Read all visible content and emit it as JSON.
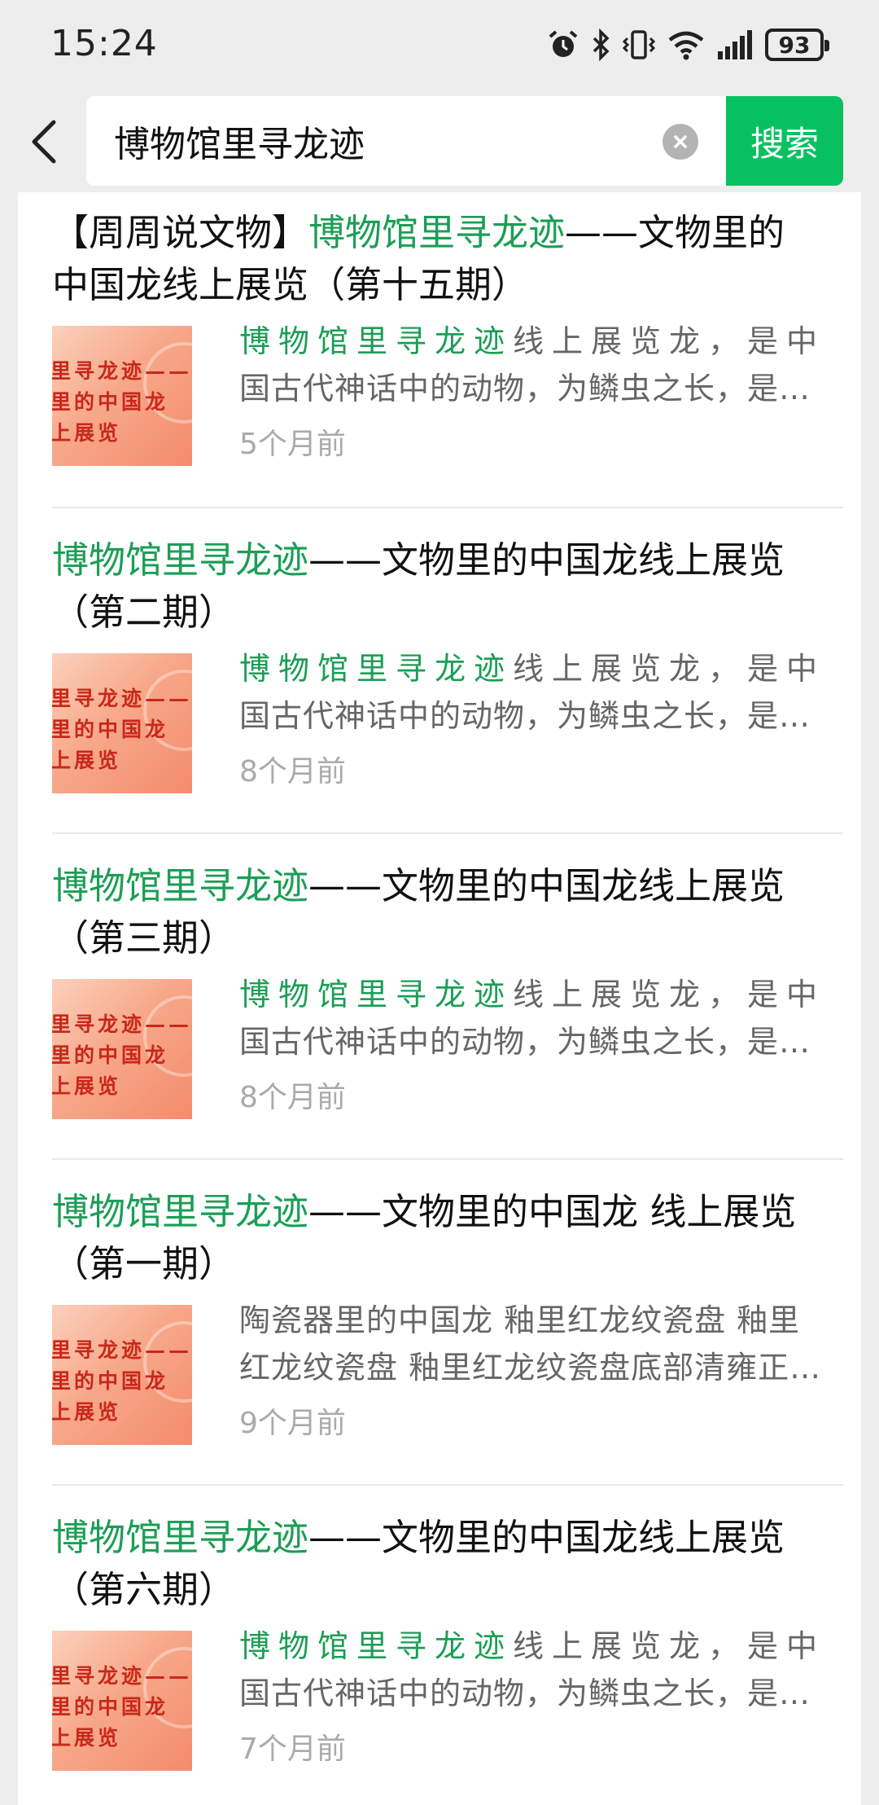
{
  "status_bar": {
    "time": "15:24",
    "battery": "93",
    "icons": [
      "alarm-icon",
      "bluetooth-icon",
      "vibrate-icon",
      "wifi-icon",
      "signal-icon",
      "battery-icon"
    ]
  },
  "search": {
    "query": "博物馆里寻龙迹",
    "button_label": "搜索"
  },
  "results": [
    {
      "title_prefix": "【周周说文物】",
      "title_highlight": "博物馆里寻龙迹",
      "title_line1_rest": "——文物里的",
      "title_line2": "中国龙线上展览（第十五期）",
      "snippet_highlight": "博物馆里寻龙迹",
      "snippet_line1_rest": "线上展览龙，是中",
      "snippet_line2": "国古代神话中的动物，为鳞虫之长，是…",
      "time": "5个月前"
    },
    {
      "title_prefix": "",
      "title_highlight": "博物馆里寻龙迹",
      "title_line1_rest": "——文物里的中国龙线上展览",
      "title_line2": "（第二期）",
      "snippet_highlight": "博物馆里寻龙迹",
      "snippet_line1_rest": "线上展览龙，是中",
      "snippet_line2": "国古代神话中的动物，为鳞虫之长，是…",
      "time": "8个月前"
    },
    {
      "title_prefix": "",
      "title_highlight": "博物馆里寻龙迹",
      "title_line1_rest": "——文物里的中国龙线上展览",
      "title_line2": "（第三期）",
      "snippet_highlight": "博物馆里寻龙迹",
      "snippet_line1_rest": "线上展览龙，是中",
      "snippet_line2": "国古代神话中的动物，为鳞虫之长，是…",
      "time": "8个月前"
    },
    {
      "title_prefix": "",
      "title_highlight": "博物馆里寻龙迹",
      "title_line1_rest": "——文物里的中国龙 线上展览",
      "title_line2": "（第一期）",
      "snippet_highlight": "",
      "snippet_line1_rest": "陶瓷器里的中国龙 釉里红龙纹瓷盘 釉里",
      "snippet_line2": "红龙纹瓷盘 釉里红龙纹瓷盘底部清雍正…",
      "time": "9个月前"
    },
    {
      "title_prefix": "",
      "title_highlight": "博物馆里寻龙迹",
      "title_line1_rest": "——文物里的中国龙线上展览",
      "title_line2": "（第六期）",
      "snippet_highlight": "博物馆里寻龙迹",
      "snippet_line1_rest": "线上展览龙，是中",
      "snippet_line2": "国古代神话中的动物，为鳞虫之长，是…",
      "time": "7个月前"
    }
  ],
  "thumbnail_text": [
    "里寻龙迹——",
    "里的中国龙",
    "上展览"
  ],
  "colors": {
    "accent_green": "#07c160",
    "highlight_green": "#1b9e55",
    "background": "#ededed"
  }
}
